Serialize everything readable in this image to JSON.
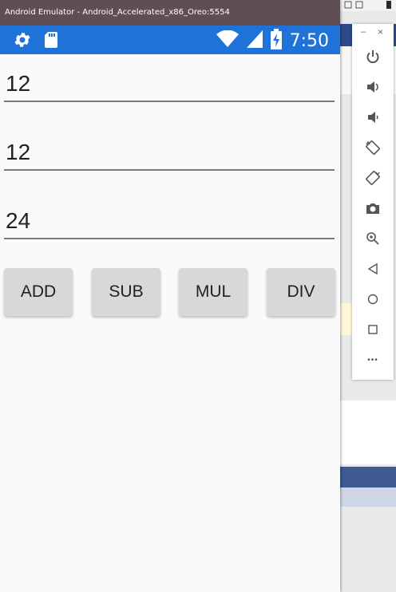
{
  "window": {
    "title": "Android Emulator - Android_Accelerated_x86_Oreo:5554"
  },
  "statusbar": {
    "time": "7:50",
    "icons": [
      "settings-icon",
      "sdcard-icon",
      "wifi-icon",
      "signal-icon",
      "battery-icon"
    ]
  },
  "app": {
    "field1": "12",
    "field2": "12",
    "result": "24",
    "buttons": {
      "add": "ADD",
      "sub": "SUB",
      "mul": "MUL",
      "div": "DIV"
    }
  },
  "toolbar": {
    "minimize": "–",
    "close": "×",
    "more": "•••",
    "items": [
      "power-icon",
      "volume-up-icon",
      "volume-down-icon",
      "rotate-left-icon",
      "rotate-right-icon",
      "camera-icon",
      "zoom-icon",
      "back-icon",
      "home-icon",
      "overview-icon",
      "more-icon"
    ]
  },
  "colors": {
    "statusbar": "#1f73d8",
    "titlebar": "#5f4f52",
    "button": "#d8d8d8",
    "panel_icon": "#555555"
  }
}
